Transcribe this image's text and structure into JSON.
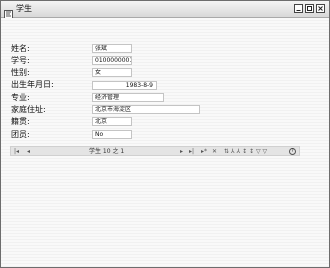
{
  "window": {
    "title": "学生"
  },
  "form": {
    "fields": [
      {
        "label": "姓名:",
        "value": "张斌"
      },
      {
        "label": "学号:",
        "value": "0100000001"
      },
      {
        "label": "性别:",
        "value": "女"
      },
      {
        "label": "出生年月日:",
        "value": "1983-8-9"
      },
      {
        "label": "专业:",
        "value": "经济管理"
      },
      {
        "label": "家庭住址:",
        "value": "北京市海淀区"
      },
      {
        "label": "籍贯:",
        "value": "北京"
      },
      {
        "label": "团员:",
        "value": "No"
      }
    ]
  },
  "navigator": {
    "first": "|◂",
    "prev": "◂",
    "record_text": "学生 10 之 1",
    "next": "▸",
    "last": "▸|",
    "add": "▸*",
    "delete": "✕",
    "tools": "⇅ ⅄ ⅄ ↕ ↕ ▽ ▽",
    "help": "?"
  },
  "colors": {
    "window_border": "#6d6d6d",
    "field_border": "#c4c4c4"
  }
}
